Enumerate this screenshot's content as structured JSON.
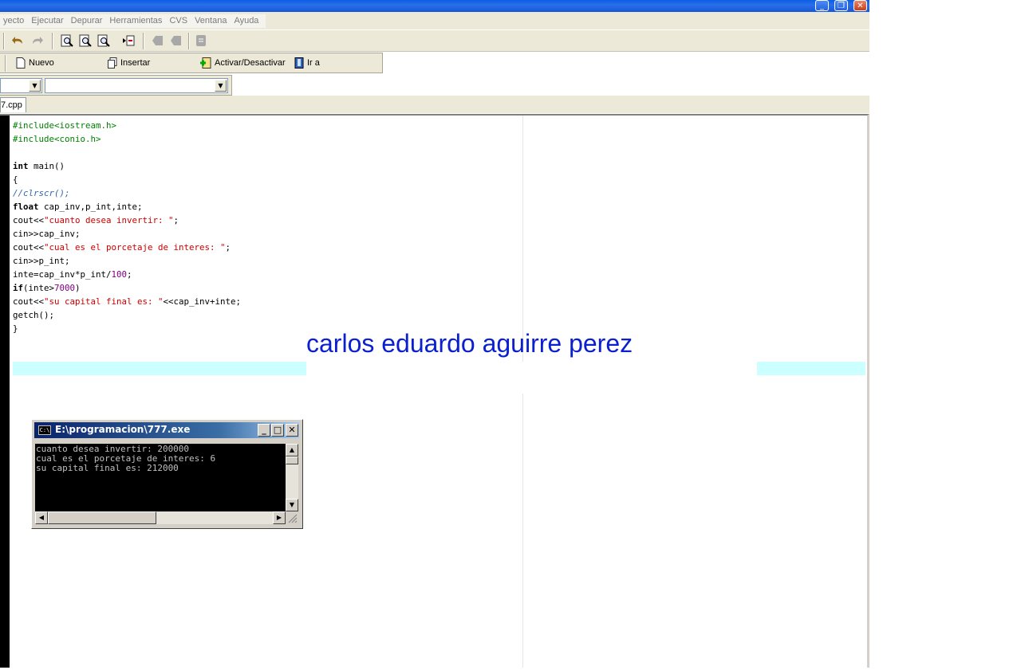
{
  "menu": [
    "yecto",
    "Ejecutar",
    "Depurar",
    "Herramientas",
    "CVS",
    "Ventana",
    "Ayuda"
  ],
  "window_buttons": {
    "minimize": "_",
    "restore": "❐",
    "close": "✕"
  },
  "toolbar2": {
    "nuevo": "Nuevo",
    "insertar": "Insertar",
    "activar": "Activar/Desactivar",
    "ir_a": "Ir a"
  },
  "tab": {
    "label": "7.cpp"
  },
  "code_lines": [
    {
      "parts": [
        {
          "t": "#include<iostream.h>",
          "c": "pp"
        }
      ]
    },
    {
      "parts": [
        {
          "t": "#include<conio.h>",
          "c": "pp"
        }
      ]
    },
    {
      "parts": []
    },
    {
      "parts": [
        {
          "t": "int",
          "c": "kw"
        },
        {
          "t": " main()",
          "c": ""
        }
      ]
    },
    {
      "parts": [
        {
          "t": "{",
          "c": ""
        }
      ]
    },
    {
      "parts": [
        {
          "t": "//clrscr();",
          "c": "cm"
        }
      ]
    },
    {
      "parts": [
        {
          "t": "float",
          "c": "kw"
        },
        {
          "t": " cap_inv,p_int,inte;",
          "c": ""
        }
      ]
    },
    {
      "parts": [
        {
          "t": "cout<<",
          "c": ""
        },
        {
          "t": "\"cuanto desea invertir: \"",
          "c": "st"
        },
        {
          "t": ";",
          "c": ""
        }
      ]
    },
    {
      "parts": [
        {
          "t": "cin>>cap_inv;",
          "c": ""
        }
      ]
    },
    {
      "parts": [
        {
          "t": "cout<<",
          "c": ""
        },
        {
          "t": "\"cual es el porcetaje de interes: \"",
          "c": "st"
        },
        {
          "t": ";",
          "c": ""
        }
      ]
    },
    {
      "parts": [
        {
          "t": "cin>>p_int;",
          "c": ""
        }
      ]
    },
    {
      "parts": [
        {
          "t": "inte=cap_inv*p_int/",
          "c": ""
        },
        {
          "t": "100",
          "c": "nm"
        },
        {
          "t": ";",
          "c": ""
        }
      ]
    },
    {
      "parts": [
        {
          "t": "if",
          "c": "kw"
        },
        {
          "t": "(inte>",
          "c": ""
        },
        {
          "t": "7000",
          "c": "nm"
        },
        {
          "t": ")",
          "c": ""
        }
      ]
    },
    {
      "parts": [
        {
          "t": "cout<<",
          "c": ""
        },
        {
          "t": "\"su capital final es: \"",
          "c": "st"
        },
        {
          "t": "<<cap_inv+inte;",
          "c": ""
        }
      ]
    },
    {
      "parts": [
        {
          "t": "getch();",
          "c": ""
        }
      ]
    },
    {
      "parts": [
        {
          "t": "}",
          "c": ""
        }
      ]
    }
  ],
  "overlay_text": "carlos eduardo aguirre perez",
  "console": {
    "title": "E:\\programacion\\777.exe",
    "icon_text": "C:\\",
    "lines": [
      "cuanto desea invertir: 200000",
      "cual es el porcetaje de interes: 6",
      "su capital final es: 212000"
    ]
  },
  "colors": {
    "overlay": "#0a1fcf",
    "highlight": "#ccffff",
    "string": "#cc0000",
    "preprocessor": "#008000",
    "comment": "#3366aa",
    "number": "#800080"
  }
}
